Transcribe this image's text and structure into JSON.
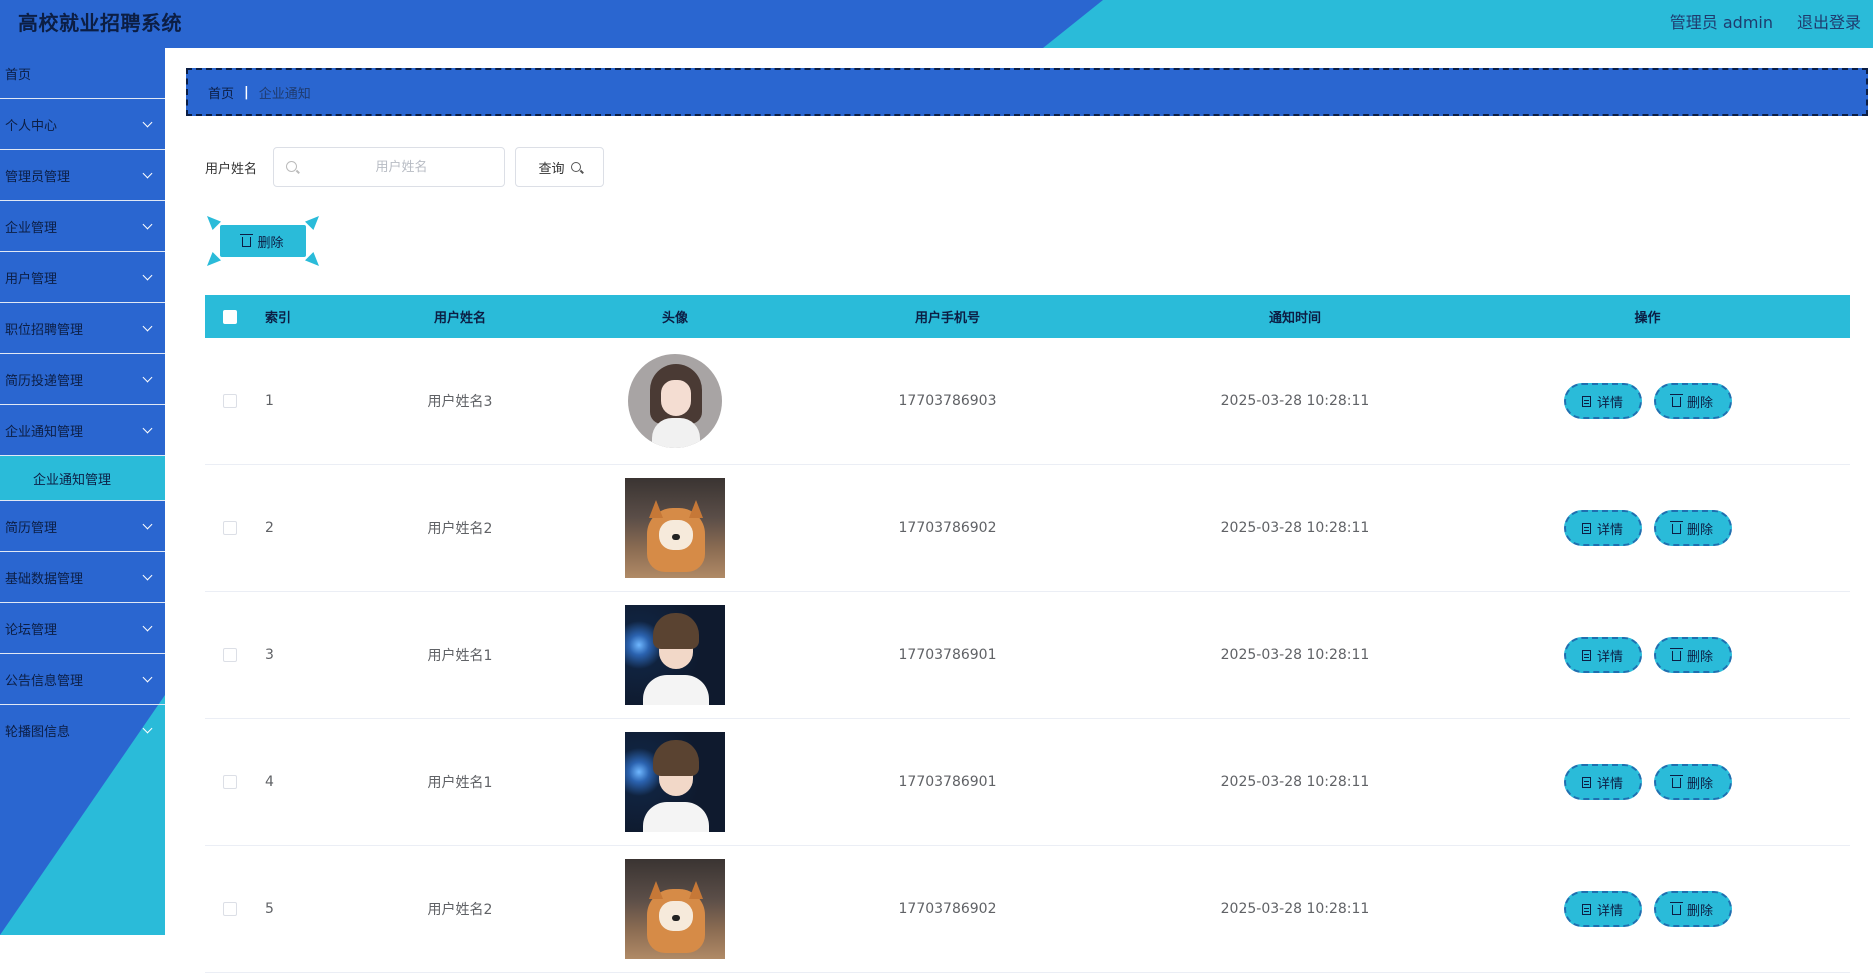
{
  "app": {
    "title": "高校就业招聘系统",
    "user": "管理员 admin",
    "logout": "退出登录"
  },
  "colors": {
    "primary": "#2a66d0",
    "accent": "#2abbd9",
    "text_dark": "#0c1e44"
  },
  "sidebar": {
    "items": [
      {
        "label": "首页",
        "expandable": false
      },
      {
        "label": "个人中心",
        "expandable": true
      },
      {
        "label": "管理员管理",
        "expandable": true
      },
      {
        "label": "企业管理",
        "expandable": true
      },
      {
        "label": "用户管理",
        "expandable": true
      },
      {
        "label": "职位招聘管理",
        "expandable": true
      },
      {
        "label": "简历投递管理",
        "expandable": true
      },
      {
        "label": "企业通知管理",
        "expandable": true,
        "sub": "企业通知管理"
      },
      {
        "label": "简历管理",
        "expandable": true
      },
      {
        "label": "基础数据管理",
        "expandable": true
      },
      {
        "label": "论坛管理",
        "expandable": true
      },
      {
        "label": "公告信息管理",
        "expandable": true
      },
      {
        "label": "轮播图信息",
        "expandable": true
      }
    ]
  },
  "breadcrumb": {
    "home": "首页",
    "separator": "|",
    "current": "企业通知"
  },
  "search": {
    "label": "用户姓名",
    "placeholder": "用户姓名",
    "value": "",
    "button": "查询",
    "icon": "search-icon"
  },
  "toolbar": {
    "delete_label": "删除",
    "delete_icon": "trash-icon"
  },
  "table": {
    "headers": {
      "index": "索引",
      "name": "用户姓名",
      "avatar": "头像",
      "phone": "用户手机号",
      "time": "通知时间",
      "ops": "操作"
    },
    "detail_label": "详情",
    "delete_label": "删除",
    "rows": [
      {
        "index": "1",
        "name": "用户姓名3",
        "avatar": "girl-illustration",
        "phone": "17703786903",
        "time": "2025-03-28 10:28:11"
      },
      {
        "index": "2",
        "name": "用户姓名2",
        "avatar": "shiba-dog",
        "phone": "17703786902",
        "time": "2025-03-28 10:28:11"
      },
      {
        "index": "3",
        "name": "用户姓名1",
        "avatar": "young-man",
        "phone": "17703786901",
        "time": "2025-03-28 10:28:11"
      },
      {
        "index": "4",
        "name": "用户姓名1",
        "avatar": "young-man",
        "phone": "17703786901",
        "time": "2025-03-28 10:28:11"
      },
      {
        "index": "5",
        "name": "用户姓名2",
        "avatar": "shiba-dog",
        "phone": "17703786902",
        "time": "2025-03-28 10:28:11"
      }
    ]
  }
}
